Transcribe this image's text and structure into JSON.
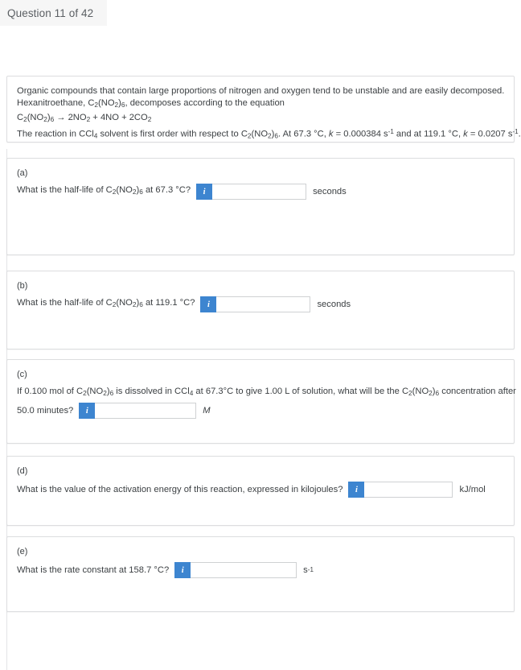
{
  "header": {
    "question_label": "Question 11 of 42"
  },
  "colors": {
    "info_button_blue": "#3d85d0",
    "card_border": "#dcdddf",
    "tab_background": "#f6f6f6",
    "text": "#3c4043"
  },
  "stem": {
    "line1": "Organic compounds that contain large proportions of nitrogen and oxygen tend to be unstable and are easily decomposed.",
    "line2_pre": "Hexanitroethane, C",
    "line2_sub1": "2",
    "line2_mid": "(NO",
    "line2_sub2": "2",
    "line2_mid2": ")",
    "line2_sub3": "6",
    "line2_post": ", decomposes according to the equation",
    "equation": "C2(NO2)6 → 2NO2 + 4NO + 2CO2",
    "line4_pre": "The reaction in CCl",
    "line4_sub1": "4",
    "line4_mid1": " solvent is first order with respect to C",
    "line4_sub2": "2",
    "line4_mid2": "(NO",
    "line4_sub3": "2",
    "line4_mid3": ")",
    "line4_sub4": "6",
    "line4_mid4": ". At 67.3 °C, ",
    "line4_k1": "k",
    "line4_val1": " = 0.000384 s",
    "line4_exp1": "-1",
    "line4_mid5": " and at 119.1 °C, ",
    "line4_k2": "k",
    "line4_val2": " = 0.0207 s",
    "line4_exp2": "-1",
    "line4_end": "."
  },
  "parts": {
    "a": {
      "letter": "(a)",
      "question_pre": "What is the half-life of C",
      "sub1": "2",
      "mid1": "(NO",
      "sub2": "2",
      "mid2": ")",
      "sub3": "6",
      "question_post": " at 67.3 °C?",
      "input_value": "",
      "unit": "seconds",
      "info_icon": "info-icon",
      "info_label": "i"
    },
    "b": {
      "letter": "(b)",
      "question_pre": "What is the half-life of C",
      "sub1": "2",
      "mid1": "(NO",
      "sub2": "2",
      "mid2": ")",
      "sub3": "6",
      "question_post": " at 119.1 °C?",
      "input_value": "",
      "unit": "seconds",
      "info_label": "i"
    },
    "c": {
      "letter": "(c)",
      "line1_pre": "If 0.100 mol of C",
      "sub1": "2",
      "mid1": "(NO",
      "sub2": "2",
      "mid2": ")",
      "sub3": "6",
      "line1_mid": " is dissolved in CCl",
      "sub4": "4",
      "line1_mid2": " at 67.3°C to give 1.00 L of solution, what will be the C",
      "sub5": "2",
      "mid3": "(NO",
      "sub6": "2",
      "mid4": ")",
      "sub7": "6",
      "line1_end": " concentration after",
      "line2": "50.0 minutes?",
      "input_value": "",
      "unit": "M",
      "info_label": "i"
    },
    "d": {
      "letter": "(d)",
      "question": "What is the value of the activation energy of this reaction, expressed in kilojoules?",
      "input_value": "",
      "unit": "kJ/mol",
      "info_label": "i"
    },
    "e": {
      "letter": "(e)",
      "question": "What is the rate constant at 158.7 °C?",
      "input_value": "",
      "unit_base": "s",
      "unit_exp": "-1",
      "info_label": "i"
    }
  }
}
